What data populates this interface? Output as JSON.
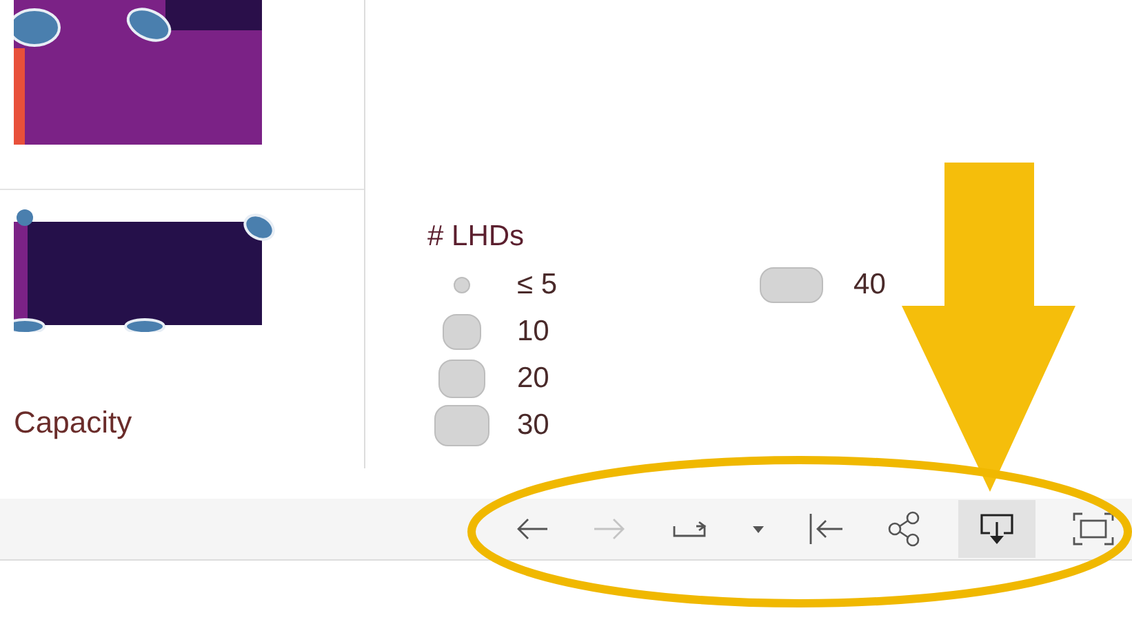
{
  "left_panel": {
    "label": "Capacity"
  },
  "legend": {
    "title": "# LHDs",
    "items": [
      {
        "label": "≤ 5"
      },
      {
        "label": "10"
      },
      {
        "label": "20"
      },
      {
        "label": "30"
      },
      {
        "label": "40"
      }
    ]
  },
  "toolbar": {
    "buttons": [
      {
        "kind": "undo",
        "disabled": false,
        "highlighted": false
      },
      {
        "kind": "redo",
        "disabled": true,
        "highlighted": false
      },
      {
        "kind": "revert",
        "disabled": false,
        "highlighted": false
      },
      {
        "kind": "dropdown",
        "disabled": false,
        "highlighted": false
      },
      {
        "kind": "reset",
        "disabled": false,
        "highlighted": false
      },
      {
        "kind": "share",
        "disabled": false,
        "highlighted": false
      },
      {
        "kind": "download",
        "disabled": false,
        "highlighted": true
      },
      {
        "kind": "fullscreen",
        "disabled": false,
        "highlighted": false
      }
    ]
  },
  "annotation": {
    "arrow": true,
    "ellipse": true
  }
}
